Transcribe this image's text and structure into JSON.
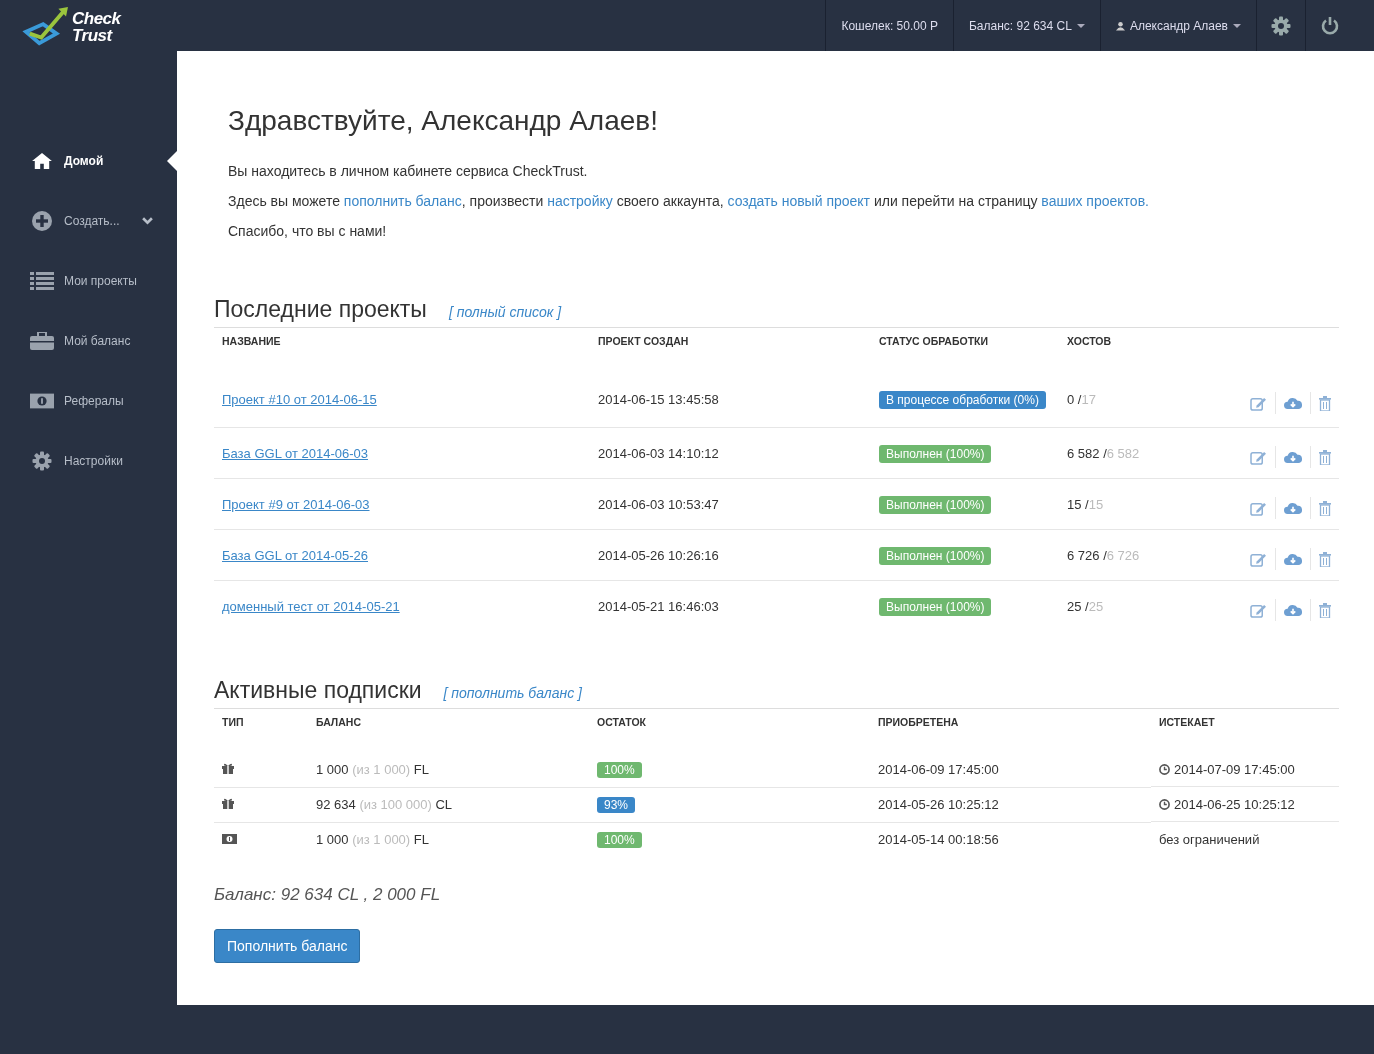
{
  "logo": {
    "line1": "Check",
    "line2": "Trust"
  },
  "topbar": {
    "wallet": "Кошелек: 50.00 Р",
    "balance": "Баланс: 92 634 CL",
    "user": "Александр Алаев"
  },
  "sidebar": {
    "items": [
      {
        "label": "Домой",
        "selected": true,
        "has_caret": false
      },
      {
        "label": "Создать...",
        "selected": false,
        "has_caret": true
      },
      {
        "label": "Мои проекты",
        "selected": false,
        "has_caret": false
      },
      {
        "label": "Мой баланс",
        "selected": false,
        "has_caret": false
      },
      {
        "label": "Рефералы",
        "selected": false,
        "has_caret": false
      },
      {
        "label": "Настройки",
        "selected": false,
        "has_caret": false
      }
    ]
  },
  "greeting": {
    "title": "Здравствуйте, Александр Алаев!",
    "line1": "Вы находитесь в личном кабинете сервиса CheckTrust.",
    "line2": [
      {
        "text": "Здесь вы можете ",
        "link": false
      },
      {
        "text": "пополнить баланс",
        "link": true
      },
      {
        "text": ", произвести ",
        "link": false
      },
      {
        "text": "настройку",
        "link": true
      },
      {
        "text": " своего аккаунта, ",
        "link": false
      },
      {
        "text": "создать новый проект",
        "link": true
      },
      {
        "text": " или перейти на страницу ",
        "link": false
      },
      {
        "text": "ваших проектов.",
        "link": true
      }
    ],
    "line3": "Спасибо, что вы с нами!"
  },
  "projects": {
    "title": "Последние проекты",
    "link": "[ полный список ]",
    "columns": [
      "НАЗВАНИЕ",
      "ПРОЕКТ СОЗДАН",
      "СТАТУС ОБРАБОТКИ",
      "ХОСТОВ"
    ],
    "rows": [
      {
        "name": "Проект #10 от 2014-06-15",
        "created": "2014-06-15 13:45:58",
        "status": {
          "text": "В процессе обработки (0%)",
          "kind": "processing"
        },
        "hosts_done": "0 /",
        "hosts_total": "17"
      },
      {
        "name": "База GGL от 2014-06-03",
        "created": "2014-06-03 14:10:12",
        "status": {
          "text": "Выполнен (100%)",
          "kind": "done"
        },
        "hosts_done": "6 582 /",
        "hosts_total": "6 582"
      },
      {
        "name": "Проект #9 от 2014-06-03",
        "created": "2014-06-03 10:53:47",
        "status": {
          "text": "Выполнен (100%)",
          "kind": "done"
        },
        "hosts_done": "15 /",
        "hosts_total": "15"
      },
      {
        "name": "База GGL от 2014-05-26",
        "created": "2014-05-26 10:26:16",
        "status": {
          "text": "Выполнен (100%)",
          "kind": "done"
        },
        "hosts_done": "6 726 /",
        "hosts_total": "6 726"
      },
      {
        "name": "доменный тест от 2014-05-21",
        "created": "2014-05-21 16:46:03",
        "status": {
          "text": "Выполнен (100%)",
          "kind": "done"
        },
        "hosts_done": "25 /",
        "hosts_total": "25"
      }
    ]
  },
  "subscriptions": {
    "title": "Активные подписки",
    "link": "[ пополнить баланс ]",
    "columns": [
      "ТИП",
      "БАЛАНС",
      "ОСТАТОК",
      "ПРИОБРЕТЕНА",
      "ИСТЕКАЕТ"
    ],
    "rows": [
      {
        "kind": "gift",
        "amount": "1 000",
        "of": "(из 1 000)",
        "unit": "FL",
        "remaining": {
          "text": "100%",
          "kind": "full"
        },
        "purchased": "2014-06-09 17:45:00",
        "expires": {
          "text": "2014-07-09 17:45:00",
          "kind": "dated"
        }
      },
      {
        "kind": "gift",
        "amount": "92 634",
        "of": "(из 100 000)",
        "unit": "CL",
        "remaining": {
          "text": "93%",
          "kind": "partial"
        },
        "purchased": "2014-05-26 10:25:12",
        "expires": {
          "text": "2014-06-25 10:25:12",
          "kind": "dated"
        }
      },
      {
        "kind": "money",
        "amount": "1 000",
        "of": "(из 1 000)",
        "unit": "FL",
        "remaining": {
          "text": "100%",
          "kind": "full"
        },
        "purchased": "2014-05-14 00:18:56",
        "expires": {
          "text": "без ограничений",
          "kind": "unlimited"
        }
      }
    ]
  },
  "total": "Баланс: 92 634 CL , 2 000 FL",
  "button": "Пополнить баланс"
}
